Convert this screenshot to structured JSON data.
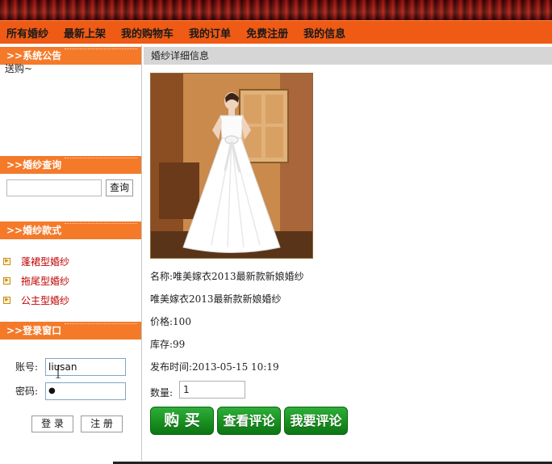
{
  "nav": {
    "items": [
      "所有婚纱",
      "最新上架",
      "我的购物车",
      "我的订单",
      "免费注册",
      "我的信息"
    ]
  },
  "sidebar": {
    "notice": {
      "title": ">>系统公告",
      "text": "送购~"
    },
    "search": {
      "title": ">>婚纱查询",
      "button_label": "查询",
      "value": ""
    },
    "styles": {
      "title": ">>婚纱款式",
      "items": [
        "蓬裙型婚纱",
        "拖尾型婚纱",
        "公主型婚纱"
      ]
    },
    "login": {
      "title": ">>登录窗口",
      "account_label": "账号:",
      "account_value": "liusan",
      "password_label": "密码:",
      "password_value": "●",
      "login_button": "登 录",
      "register_button": "注 册"
    }
  },
  "detail": {
    "header": "婚纱详细信息",
    "name_line": "名称:唯美嫁衣2013最新款新娘婚纱",
    "description": "唯美嫁衣2013最新款新娘婚纱",
    "price_line": "价格:100",
    "stock_line": "库存:99",
    "published_line": "发布时间:2013-05-15 10:19",
    "quantity_label": "数量:",
    "quantity_value": "1",
    "buy_button": "购 买",
    "view_reviews_button": "查看评论",
    "write_review_button": "我要评论"
  },
  "colors": {
    "nav_bg": "#ef5a14",
    "sidebar_header_bg": "#f47a2a",
    "detail_header_bg": "#d6d6d6",
    "style_link": "#c00000",
    "button_green": "#18901f"
  }
}
